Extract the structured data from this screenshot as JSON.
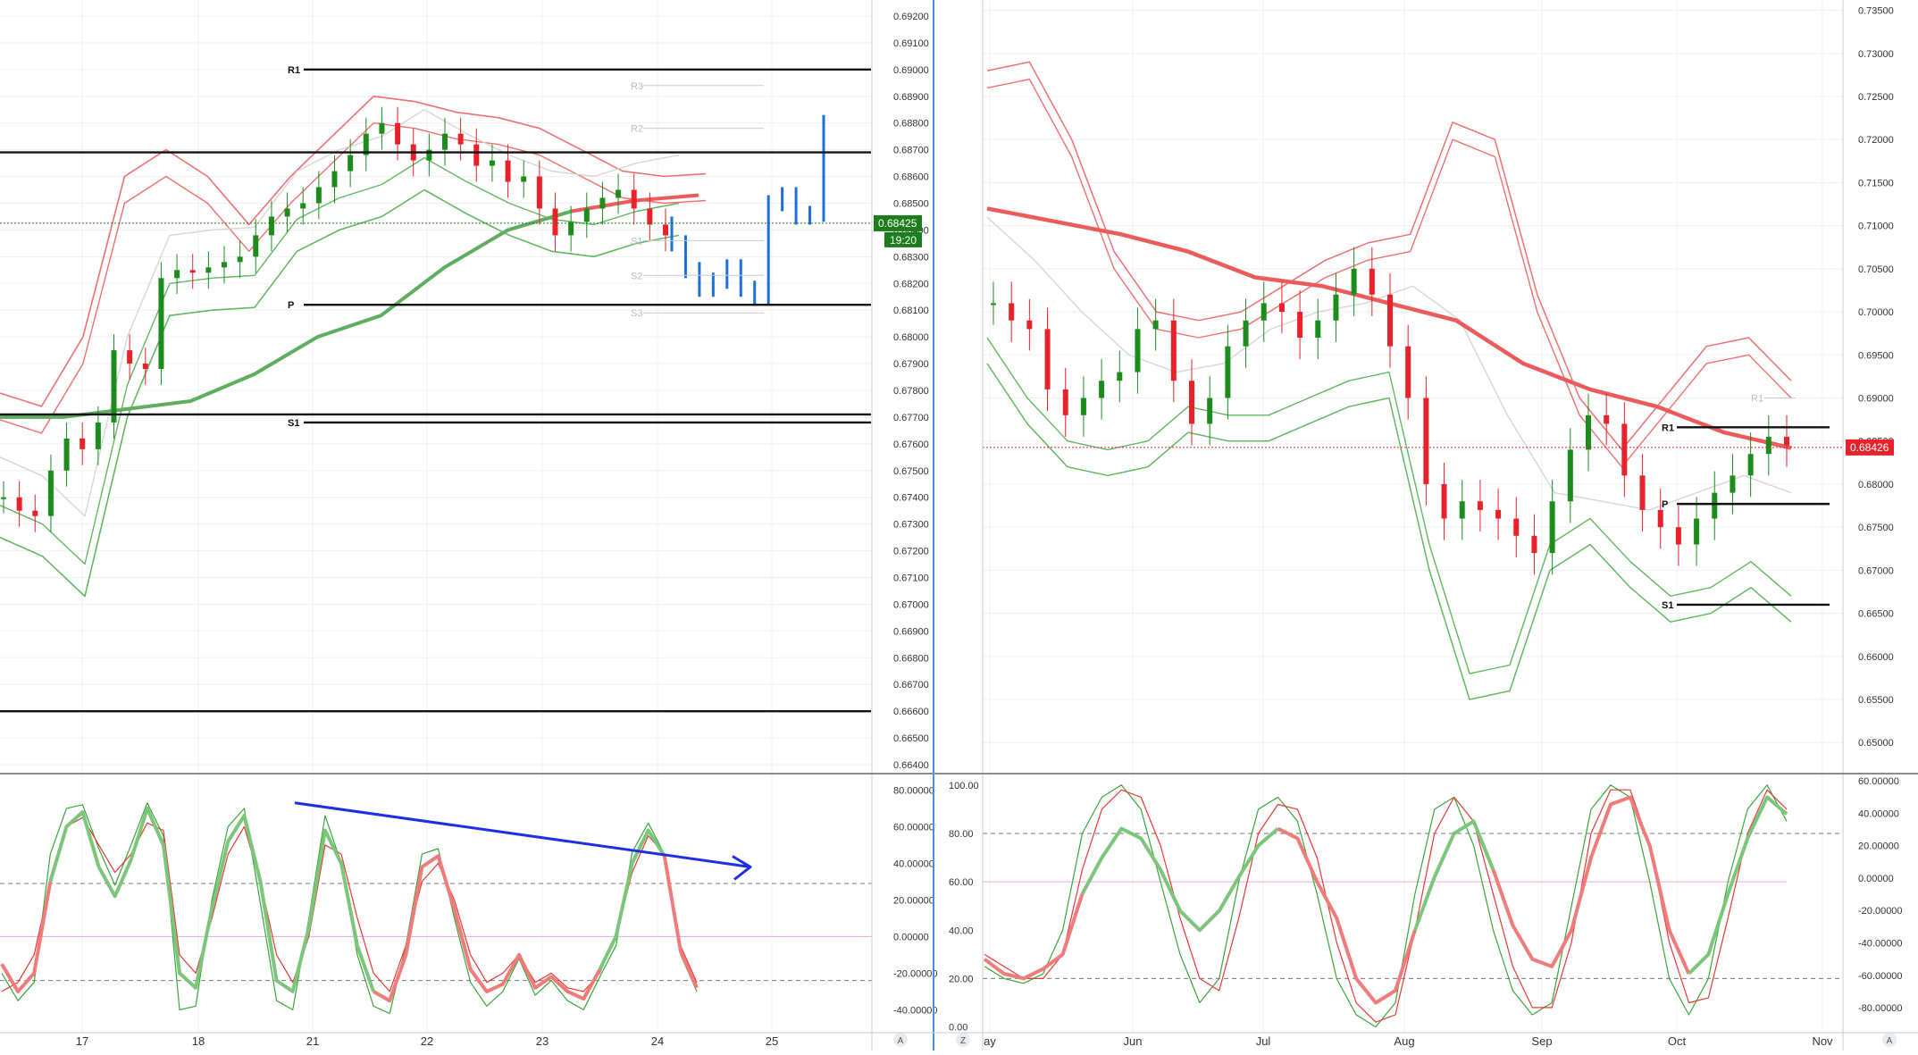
{
  "colors": {
    "grid": "#eef0f3",
    "bull": "#1c8c1c",
    "bear": "#e8222a",
    "blue_bar": "#1e6fd9",
    "band_red": "#f07070",
    "band_green": "#62b862",
    "ma_red": "#ec5b5b",
    "ma_green": "#5fad5f",
    "gray_line": "#d6d6d6",
    "level": "#111111",
    "faint_level": "#c8cbd0",
    "price_left": "#1b7d1b",
    "price_right": "#e8222a",
    "divergence": "#1d2fe0",
    "osc_fast": "#3aa53a",
    "osc_slow": "#e53935",
    "osc_thick_up": "#7cc67c",
    "osc_thick_dn": "#f07b7b",
    "mid_line": "#e3a8e8"
  },
  "left_panel": {
    "price_label": "0.68425",
    "countdown": "19:20",
    "y_ticks": [
      "0.69200",
      "0.69100",
      "0.69000",
      "0.68900",
      "0.68800",
      "0.68700",
      "0.68600",
      "0.68500",
      "0.68400",
      "0.68300",
      "0.68200",
      "0.68100",
      "0.68000",
      "0.67900",
      "0.67800",
      "0.67700",
      "0.67600",
      "0.67500",
      "0.67400",
      "0.67300",
      "0.67200",
      "0.67100",
      "0.67000",
      "0.66900",
      "0.66800",
      "0.66700",
      "0.66600",
      "0.66500",
      "0.66400"
    ],
    "x_ticks": [
      "17",
      "18",
      "21",
      "22",
      "23",
      "24",
      "25"
    ],
    "levels": [
      {
        "label": "R1",
        "value": 0.69
      },
      {
        "label": "",
        "value": 0.6869
      },
      {
        "label": "P",
        "value": 0.6812
      },
      {
        "label": "",
        "value": 0.6771
      },
      {
        "label": "S1",
        "value": 0.6768
      },
      {
        "label": "",
        "value": 0.666
      }
    ],
    "faint_levels": [
      {
        "label": "R3",
        "value": 0.6894
      },
      {
        "label": "R2",
        "value": 0.6878
      },
      {
        "label": "S1",
        "value": 0.6836
      },
      {
        "label": "S2",
        "value": 0.6823
      },
      {
        "label": "S3",
        "value": 0.6809
      }
    ],
    "osc_ticks": [
      "80.00000",
      "60.00000",
      "40.00000",
      "20.00000",
      "0.00000",
      "-20.00000",
      "-40.00000"
    ],
    "osc_corner": "A"
  },
  "right_panel": {
    "price_label": "0.68426",
    "y_ticks": [
      "0.73500",
      "0.73000",
      "0.72500",
      "0.72000",
      "0.71500",
      "0.71000",
      "0.70500",
      "0.70000",
      "0.69500",
      "0.69000",
      "0.68500",
      "0.68000",
      "0.67500",
      "0.67000",
      "0.66500",
      "0.66000",
      "0.65500",
      "0.65000"
    ],
    "x_ticks": [
      "ay",
      "Jun",
      "Jul",
      "Aug",
      "Sep",
      "Oct",
      "Nov"
    ],
    "levels": [
      {
        "label": "R1",
        "value": 0.6866
      },
      {
        "label": "P",
        "value": 0.6777
      },
      {
        "label": "S1",
        "value": 0.666
      }
    ],
    "faint_levels": [
      {
        "label": "R1",
        "value": 0.69
      }
    ],
    "osc_left_ticks": [
      "100.00",
      "80.00",
      "60.00",
      "40.00",
      "20.00",
      "0.00"
    ],
    "osc_right_ticks": [
      "60.00000",
      "40.00000",
      "20.00000",
      "0.00000",
      "-20.00000",
      "-40.00000",
      "-60.00000",
      "-80.00000"
    ],
    "osc_corner_left": "Z",
    "osc_corner_right": "A"
  },
  "chart_data": [
    {
      "type": "candlestick",
      "title": "",
      "timeframe_ticks": [
        "17",
        "18",
        "21",
        "22",
        "23",
        "24",
        "25"
      ],
      "ylim": [
        0.6637,
        0.6926
      ],
      "current_price": 0.68425,
      "series": [
        {
          "name": "",
          "values": [
            0.674,
            0.6735,
            0.6733,
            0.675,
            0.6762,
            0.6758,
            0.6768,
            0.6795,
            0.679,
            0.6788,
            0.6822,
            0.6825,
            0.6824,
            0.6826,
            0.6828,
            0.683,
            0.6838,
            0.6845,
            0.6848,
            0.685,
            0.6856,
            0.6862,
            0.6868,
            0.6876,
            0.688,
            0.6872,
            0.6866,
            0.687,
            0.6876,
            0.6872,
            0.6864,
            0.6866,
            0.6858,
            0.686,
            0.6848,
            0.6838,
            0.6843,
            0.6848,
            0.6852,
            0.6855,
            0.6848,
            0.6842,
            0.6838
          ]
        },
        {
          "name": "",
          "values": [
            0.6835,
            0.6825,
            0.6818,
            0.6821,
            0.6826,
            0.6818,
            0.6815,
            0.685,
            0.6853,
            0.6845,
            0.6846,
            0.688
          ]
        }
      ],
      "bands_upper": [
        0.6779,
        0.6774,
        0.68,
        0.686,
        0.687,
        0.686,
        0.6842,
        0.686,
        0.6875,
        0.689,
        0.6888,
        0.6884,
        0.6882,
        0.6878,
        0.687,
        0.6862,
        0.686,
        0.6861
      ],
      "bands_lower": [
        0.6725,
        0.6718,
        0.6703,
        0.677,
        0.6808,
        0.681,
        0.6811,
        0.6832,
        0.684,
        0.6845,
        0.6855,
        0.6846,
        0.6838,
        0.6832,
        0.683,
        0.6835,
        0.6838
      ],
      "ma_long": [
        0.677,
        0.677,
        0.6773,
        0.6776,
        0.6786,
        0.68,
        0.6808,
        0.6826,
        0.684,
        0.6847,
        0.6851,
        0.6853
      ]
    },
    {
      "type": "candlestick",
      "title": "",
      "timeframe_ticks": [
        "ay",
        "Jun",
        "Jul",
        "Aug",
        "Sep",
        "Oct",
        "Nov"
      ],
      "ylim": [
        0.6465,
        0.7362
      ],
      "current_price": 0.68426,
      "series": [
        {
          "name": "",
          "values": [
            0.701,
            0.699,
            0.698,
            0.691,
            0.688,
            0.69,
            0.692,
            0.693,
            0.698,
            0.699,
            0.692,
            0.687,
            0.69,
            0.696,
            0.699,
            0.701,
            0.7,
            0.697,
            0.699,
            0.702,
            0.705,
            0.702,
            0.696,
            0.69,
            0.68,
            0.676,
            0.678,
            0.677,
            0.676,
            0.674,
            0.672,
            0.678,
            0.684,
            0.688,
            0.687,
            0.681,
            0.677,
            0.675,
            0.673,
            0.676,
            0.679,
            0.681,
            0.6835,
            0.6855,
            0.6845
          ]
        }
      ],
      "ma_long": [
        0.712,
        0.7105,
        0.709,
        0.707,
        0.704,
        0.703,
        0.701,
        0.699,
        0.694,
        0.691,
        0.689,
        0.686,
        0.6842
      ]
    },
    {
      "type": "line",
      "title": "",
      "ylim": [
        -52,
        88
      ],
      "y_ticks": [
        80,
        60,
        40,
        20,
        0,
        -20,
        -40
      ],
      "reference_lines": [
        29,
        -24,
        0
      ],
      "series": [
        {
          "name": "",
          "values": [
            -20,
            -35,
            -25,
            45,
            70,
            72,
            48,
            28,
            50,
            73,
            55,
            -40,
            -38,
            20,
            60,
            70,
            18,
            -35,
            -40,
            10,
            66,
            40,
            -10,
            -38,
            -42,
            -5,
            45,
            48,
            10,
            -25,
            -38,
            -30,
            -12,
            -32,
            -24,
            -35,
            -40,
            -22,
            -5,
            46,
            62,
            45,
            -10,
            -30
          ]
        },
        {
          "name": "",
          "values": [
            -30,
            -25,
            -10,
            30,
            60,
            65,
            50,
            35,
            45,
            62,
            58,
            -10,
            -20,
            10,
            45,
            60,
            30,
            -10,
            -25,
            0,
            50,
            45,
            10,
            -20,
            -30,
            -5,
            30,
            40,
            20,
            -10,
            -25,
            -20,
            -10,
            -25,
            -20,
            -28,
            -30,
            -20,
            0,
            35,
            55,
            45,
            -5,
            -25
          ]
        },
        {
          "name": "",
          "values": [
            -15,
            -30,
            -20,
            30,
            60,
            68,
            38,
            22,
            42,
            70,
            50,
            -20,
            -28,
            15,
            52,
            66,
            30,
            -24,
            -30,
            5,
            58,
            40,
            -5,
            -30,
            -35,
            -10,
            38,
            44,
            15,
            -18,
            -30,
            -26,
            -10,
            -28,
            -22,
            -30,
            -34,
            -18,
            0,
            40,
            58,
            44,
            -8,
            -28
          ]
        }
      ],
      "annotations": [
        {
          "type": "arrow",
          "from": [
            2.6,
            73
          ],
          "to": [
            6.8,
            38
          ]
        }
      ]
    },
    {
      "type": "line",
      "title": "",
      "ylim": [
        -2,
        104
      ],
      "y_ticks_left": [
        100,
        80,
        60,
        40,
        20,
        0
      ],
      "y_ticks_right": [
        60,
        40,
        20,
        0,
        -20,
        -40,
        -60,
        -80
      ],
      "reference_lines": [
        80,
        60,
        20
      ],
      "series": [
        {
          "name": "",
          "values": [
            25,
            20,
            18,
            22,
            40,
            80,
            95,
            100,
            90,
            60,
            30,
            10,
            20,
            60,
            90,
            95,
            85,
            55,
            20,
            5,
            0,
            10,
            55,
            90,
            95,
            75,
            40,
            15,
            5,
            10,
            50,
            90,
            100,
            95,
            60,
            20,
            5,
            20,
            60,
            90,
            100,
            85
          ]
        },
        {
          "name": "",
          "values": [
            30,
            25,
            20,
            20,
            30,
            65,
            90,
            98,
            95,
            75,
            45,
            20,
            15,
            45,
            80,
            92,
            90,
            70,
            35,
            10,
            2,
            5,
            40,
            80,
            95,
            85,
            55,
            25,
            8,
            8,
            35,
            80,
            98,
            98,
            75,
            35,
            10,
            12,
            45,
            80,
            98,
            90
          ]
        },
        {
          "name": "",
          "values": [
            28,
            22,
            20,
            24,
            30,
            55,
            70,
            82,
            78,
            65,
            48,
            40,
            48,
            62,
            75,
            82,
            78,
            60,
            45,
            20,
            10,
            15,
            40,
            62,
            80,
            85,
            65,
            42,
            28,
            25,
            40,
            70,
            92,
            95,
            75,
            40,
            22,
            30,
            55,
            78,
            95,
            88
          ]
        }
      ]
    }
  ]
}
